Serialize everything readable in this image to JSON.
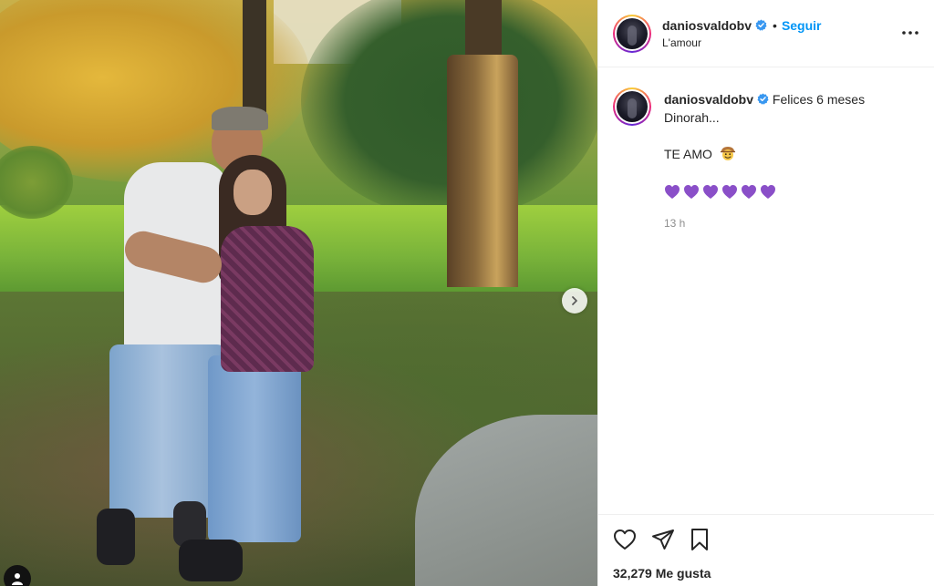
{
  "post": {
    "image_alt": "",
    "carousel_next_icon": "chevron-right-icon",
    "tag_icon": "user-tag-icon"
  },
  "header": {
    "username": "daniosvaldobv",
    "separator": "•",
    "follow_label": "Seguir",
    "location": "L'amour",
    "more_icon": "more-options-icon"
  },
  "caption": {
    "username": "daniosvaldobv",
    "line1": "Felices 6 meses",
    "line2": "Dinorah...",
    "line3": "TE AMO",
    "line3_emoji": "🤠",
    "hearts": [
      "💜",
      "💜",
      "💜",
      "💜",
      "💜",
      "💜"
    ],
    "time": "13 h"
  },
  "actions": {
    "like_icon": "heart-icon",
    "share_icon": "paper-plane-icon",
    "save_icon": "bookmark-icon",
    "likes_text": "32,279 Me gusta"
  },
  "colors": {
    "link_blue": "#0095f6",
    "verified_blue": "#3897f0",
    "heart_purple": "#8a4fc8",
    "border": "#efefef"
  }
}
